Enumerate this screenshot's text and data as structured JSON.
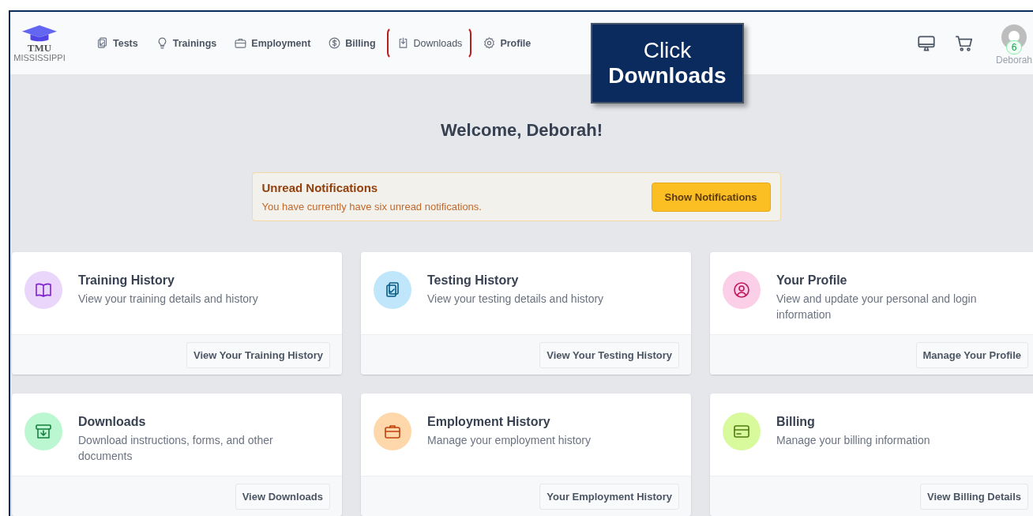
{
  "logo": {
    "title": "TMU",
    "subtitle": "MISSISSIPPI"
  },
  "nav": [
    {
      "label": "Tests",
      "kind": "clipboard",
      "highlighted": false
    },
    {
      "label": "Trainings",
      "kind": "bulb",
      "highlighted": false
    },
    {
      "label": "Employment",
      "kind": "briefcase",
      "highlighted": false
    },
    {
      "label": "Billing",
      "kind": "dollar",
      "highlighted": false
    },
    {
      "label": "Downloads",
      "kind": "download",
      "highlighted": true
    },
    {
      "label": "Profile",
      "kind": "gear",
      "highlighted": false
    }
  ],
  "user": {
    "badge": "6",
    "name": "Deborah"
  },
  "callout": {
    "line_1": "Click",
    "line_2": "Downloads"
  },
  "welcome": "Welcome, Deborah!",
  "notification": {
    "title": "Unread Notifications",
    "message": "You have currently have six unread notifications.",
    "button": "Show Notifications"
  },
  "cards": [
    {
      "kind": "book",
      "title": "Training History",
      "description": "View your training details and history",
      "button": "View Your Training History"
    },
    {
      "kind": "clipboard",
      "title": "Testing History",
      "description": "View your testing details and history",
      "button": "View Your Testing History"
    },
    {
      "kind": "user",
      "title": "Your Profile",
      "description": "View and update your personal and login information",
      "button": "Manage Your Profile"
    },
    {
      "kind": "inbox",
      "title": "Downloads",
      "description": "Download instructions, forms, and other documents",
      "button": "View Downloads"
    },
    {
      "kind": "briefcase",
      "title": "Employment History",
      "description": "Manage your employment history",
      "button": "Your Employment History"
    },
    {
      "kind": "card",
      "title": "Billing",
      "description": "Manage your billing information",
      "button": "View Billing Details"
    }
  ]
}
